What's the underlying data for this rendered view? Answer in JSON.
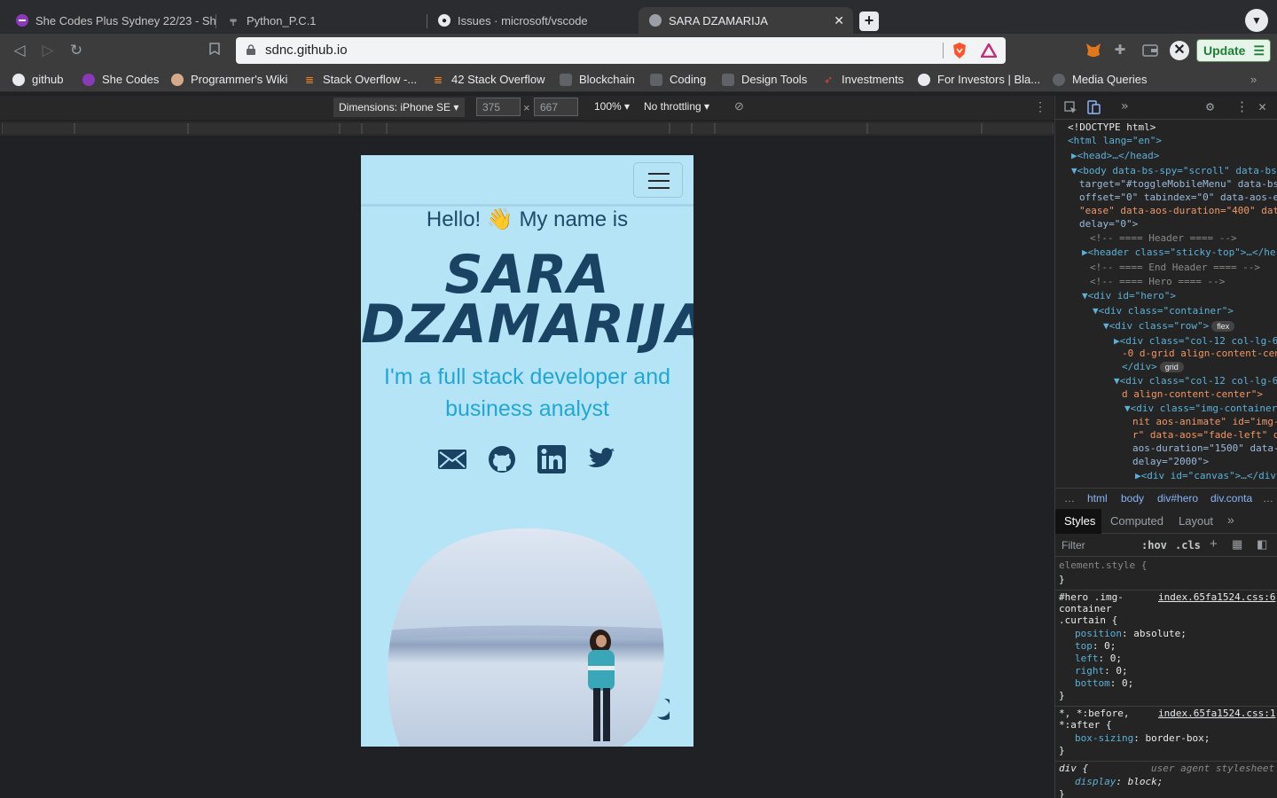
{
  "browser": {
    "tabs": [
      {
        "title": "She Codes Plus Sydney 22/23 - She",
        "icon": "shecodes-icon"
      },
      {
        "title": "Python_P.C.1",
        "icon": "doc-icon"
      },
      {
        "title": "Issues · microsoft/vscode",
        "icon": "github-icon"
      },
      {
        "title": "SARA DZAMARIJA",
        "icon": "globe-icon",
        "active": true
      }
    ],
    "url": "sdnc.github.io",
    "update_label": "Update"
  },
  "bookmarks": [
    {
      "label": "github",
      "icon": "github-icon"
    },
    {
      "label": "She Codes",
      "icon": "shecodes-icon"
    },
    {
      "label": "Programmer's Wiki",
      "icon": "avatar-icon"
    },
    {
      "label": "Stack Overflow -...",
      "icon": "stackoverflow-icon"
    },
    {
      "label": "42 Stack Overflow",
      "icon": "stackoverflow-icon"
    },
    {
      "label": "Blockchain",
      "icon": "folder-icon"
    },
    {
      "label": "Coding",
      "icon": "folder-icon"
    },
    {
      "label": "Design Tools",
      "icon": "folder-icon"
    },
    {
      "label": "Investments",
      "icon": "rocket-icon"
    },
    {
      "label": "For Investors | Bla...",
      "icon": "globe-icon"
    },
    {
      "label": "Media Queries",
      "icon": "globe-icon"
    }
  ],
  "device_toolbar": {
    "dimensions": "Dimensions: iPhone SE",
    "width": "375",
    "height": "667",
    "zoom": "100%",
    "throttling": "No throttling"
  },
  "page": {
    "greeting": "Hello! 👋 My name is",
    "name_line1": "SARA",
    "name_line2": "DZAMARIJA",
    "subtitle": "I'm a full stack developer and business analyst",
    "social": [
      "email-icon",
      "github-icon",
      "linkedin-icon",
      "twitter-icon"
    ],
    "colors": {
      "background": "#b6e4f7",
      "name": "#1a4263",
      "subtitle": "#21a6d6"
    }
  },
  "devtools": {
    "dom": [
      {
        "text": "<!DOCTYPE html>"
      },
      {
        "text": "<html lang=\"en\">"
      },
      {
        "text": "▶<head>…</head>"
      },
      {
        "text": "▼<body data-bs-spy=\"scroll\" data-bs-"
      },
      {
        "text": "target=\"#toggleMobileMenu\" data-bs-"
      },
      {
        "text": "offset=\"0\" tabindex=\"0\" data-aos-e"
      },
      {
        "text": "\"ease\" data-aos-duration=\"400\" dat"
      },
      {
        "text": "delay=\"0\">"
      },
      {
        "text": "<!-- ==== Header ==== -->"
      },
      {
        "text": "▶<header class=\"sticky-top\">…</he"
      },
      {
        "text": "<!-- ==== End Header ==== -->"
      },
      {
        "text": "<!-- ==== Hero ==== -->"
      },
      {
        "text": "▼<div id=\"hero\">"
      },
      {
        "text": "▼<div class=\"container\">"
      },
      {
        "text": "▼<div class=\"row\">"
      },
      {
        "text": "▶<div class=\"col-12 col-lg-6"
      },
      {
        "text": "-0 d-grid align-content-cen"
      },
      {
        "text": "</div>"
      },
      {
        "text": "▼<div class=\"col-12 col-lg-6"
      },
      {
        "text": "d align-content-center\">"
      },
      {
        "text": "▼<div class=\"img-container"
      },
      {
        "text": "nit aos-animate\" id=\"img-"
      },
      {
        "text": "r\" data-aos=\"fade-left\" d"
      },
      {
        "text": "aos-duration=\"1500\" data-"
      },
      {
        "text": "delay=\"2000\">"
      },
      {
        "text": "▶<div id=\"canvas\">…</div"
      }
    ],
    "badges": {
      "flex": "flex",
      "grid": "grid"
    },
    "breadcrumbs": [
      "html",
      "body",
      "div#hero",
      "div.conta"
    ],
    "tabs": [
      "Styles",
      "Computed",
      "Layout"
    ],
    "filter_placeholder": "Filter",
    "filter_tools": [
      ":hov",
      ".cls"
    ],
    "styles": [
      {
        "selector": "element.style {",
        "source": ""
      },
      {
        "selector": "}",
        "source": ""
      },
      {
        "selector": "#hero .img-",
        "source": "index.65fa1524.css:6"
      },
      {
        "selector": "container",
        "source": ""
      },
      {
        "selector": ".curtain {",
        "source": ""
      },
      {
        "prop": "position",
        "value": "absolute;"
      },
      {
        "prop": "top",
        "value": "0;"
      },
      {
        "prop": "left",
        "value": "0;"
      },
      {
        "prop": "right",
        "value": "0;"
      },
      {
        "prop": "bottom",
        "value": "0;"
      },
      {
        "selector": "}",
        "source": ""
      },
      {
        "selector": "*, *:before,",
        "source": "index.65fa1524.css:1"
      },
      {
        "selector": "*:after {",
        "source": ""
      },
      {
        "prop": "box-sizing",
        "value": "border-box;"
      },
      {
        "selector": "}",
        "source": ""
      },
      {
        "selector": "div {",
        "source": "user agent stylesheet"
      },
      {
        "prop": "display",
        "value": "block;"
      }
    ]
  }
}
